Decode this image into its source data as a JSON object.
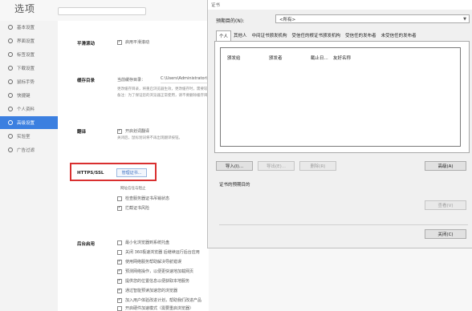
{
  "settings": {
    "title": "选项",
    "sidebar": [
      {
        "label": "基本设置",
        "active": false
      },
      {
        "label": "界面设置",
        "active": false
      },
      {
        "label": "标签设置",
        "active": false
      },
      {
        "label": "下载设置",
        "active": false
      },
      {
        "label": "鼠标手势",
        "active": false
      },
      {
        "label": "快捷键",
        "active": false
      },
      {
        "label": "个人资料",
        "active": false
      },
      {
        "label": "高级设置",
        "active": true
      },
      {
        "label": "实验室",
        "active": false
      },
      {
        "label": "广告过滤",
        "active": false
      }
    ],
    "smooth_scroll": {
      "label": "平滑滚动",
      "option": "启用平滑滚动"
    },
    "cache": {
      "label": "缓存目录",
      "path_label": "当前缓存目录：",
      "path_value": "C:\\Users\\Administrator\\AppData\\...",
      "desc1": "更改缓存目录，将重启浏览器生效，更改缓存时，需要较长时间。",
      "desc2": "备注：为了保证您的浏览器正常使用，请不要删除缓存目录。"
    },
    "translate": {
      "label": "翻译",
      "option": "开启划词翻译",
      "desc": "关闭后，鼠标划词将不再出现翻译按钮。"
    },
    "https": {
      "label": "HTTPS/SSL",
      "cert_button": "管理证书...",
      "note": "网址信任与阻止",
      "options": [
        {
          "label": "检查服务器证书吊销状态",
          "checked": false
        },
        {
          "label": "拦截证书风险",
          "checked": true
        }
      ]
    },
    "background": {
      "label": "后台启用",
      "options": [
        {
          "label": "最小化浏览器到系统托盘",
          "checked": false
        },
        {
          "label": "关闭 360极速浏览器 后继续运行后台应用",
          "checked": false
        },
        {
          "label": "使用网络服务帮助解决导航错误",
          "checked": true
        },
        {
          "label": "预测网络操作，以便更快速地加载网页",
          "checked": true
        },
        {
          "label": "提供您的位置信息以便获取本地服务",
          "checked": true
        },
        {
          "label": "通过智能预读加速您的浏览器",
          "checked": true
        },
        {
          "label": "加入用户体验改进计划，帮助我们改进产品",
          "checked": true
        },
        {
          "label": "开启硬件加速模式（需要重启浏览器）",
          "checked": false
        }
      ]
    }
  },
  "dialog": {
    "title": "证书",
    "purpose_label": "预期目的(N):",
    "purpose_value": "<所有>",
    "tabs": [
      "个人",
      "其他人",
      "中间证书颁发机构",
      "受信任的根证书颁发机构",
      "受信任的发布者",
      "未受信任的发布者"
    ],
    "columns": [
      "颁发给",
      "颁发者",
      "截止日...",
      "友好名称"
    ],
    "buttons": {
      "import": "导入(I)...",
      "export": "导出(E)...",
      "remove": "删除(R)",
      "advanced": "高级(A)",
      "view": "查看(V)",
      "close": "关闭(C)"
    },
    "purpose_text": "证书的预期目的"
  }
}
